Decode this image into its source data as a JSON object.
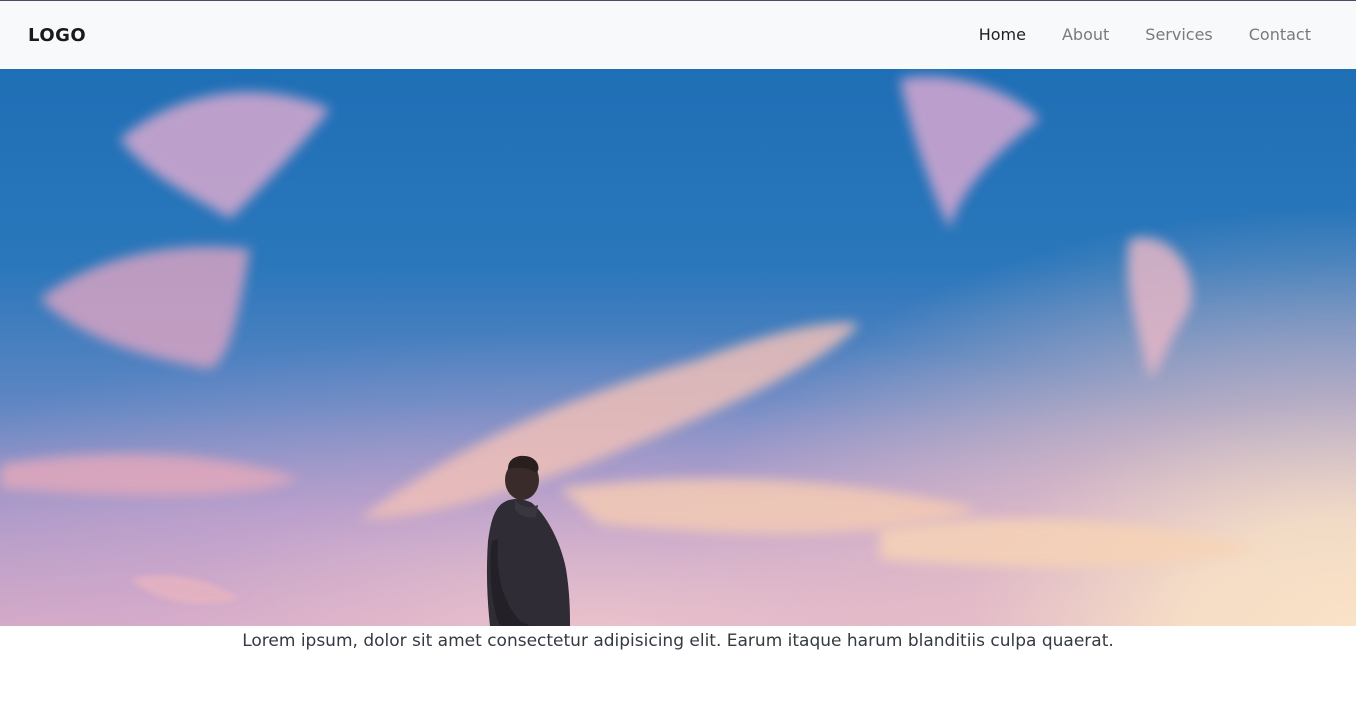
{
  "navbar": {
    "logo": "LOGO",
    "links": [
      {
        "label": "Home",
        "active": true
      },
      {
        "label": "About",
        "active": false
      },
      {
        "label": "Services",
        "active": false
      },
      {
        "label": "Contact",
        "active": false
      }
    ]
  },
  "hero": {
    "sky_top_color": "#1f6fb6",
    "sky_glow_color": "#f9e2c6"
  },
  "caption": "Lorem ipsum, dolor sit amet consectetur adipisicing elit. Earum itaque harum blanditiis culpa quaerat."
}
